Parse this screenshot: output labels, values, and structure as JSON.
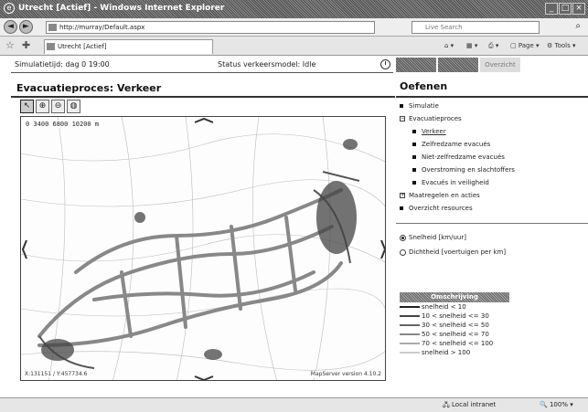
{
  "window": {
    "title": "Utrecht [Actief] - Windows Internet Explorer"
  },
  "addressbar": {
    "url": "http://murray/Default.aspx",
    "search_placeholder": "Live Search"
  },
  "tabs": [
    {
      "label": "Utrecht [Actief]"
    }
  ],
  "toolbar": {
    "page_label": "Page",
    "tools_label": "Tools"
  },
  "app_status": {
    "sim_time": "Simulatietijd: dag 0 19:00",
    "model_status": "Status verkeersmodel: Idle"
  },
  "top_tabs": {
    "active": "",
    "inactive": "Overzicht"
  },
  "left_panel": {
    "title": "Evacuatieproces: Verkeer"
  },
  "map": {
    "scale_text": "0    3400    6800    10200 m",
    "coords": "X:131151 / Y:457734.6",
    "credit": "MapServer version 4.10.2"
  },
  "right_panel": {
    "title": "Oefenen",
    "tree": [
      {
        "label": "Simulatie",
        "level": 0,
        "marker": "bullet"
      },
      {
        "label": "Evacuatieproces",
        "level": 0,
        "marker": "minus"
      },
      {
        "label": "Verkeer",
        "level": 1,
        "marker": "bullet",
        "link": true
      },
      {
        "label": "Zelfredzame evacués",
        "level": 1,
        "marker": "bullet"
      },
      {
        "label": "Niet-zelfredzame evacués",
        "level": 1,
        "marker": "bullet"
      },
      {
        "label": "Overstroming en slachtoffers",
        "level": 1,
        "marker": "bullet"
      },
      {
        "label": "Evacués in veiligheid",
        "level": 1,
        "marker": "bullet"
      },
      {
        "label": "Maatregelen en acties",
        "level": 0,
        "marker": "plus"
      },
      {
        "label": "Overzicht resources",
        "level": 0,
        "marker": "bullet"
      }
    ],
    "options": [
      {
        "label": "Snelheid [km/uur]",
        "selected": true
      },
      {
        "label": "Dichtheid [voertuigen per km]",
        "selected": false
      }
    ],
    "legend": {
      "title": "Omschrijving",
      "items": [
        {
          "label": "snelheid < 10",
          "color": "#222222"
        },
        {
          "label": "10 < snelheid <= 30",
          "color": "#444444"
        },
        {
          "label": "30 < snelheid <= 50",
          "color": "#666666"
        },
        {
          "label": "50 < snelheid <= 70",
          "color": "#888888"
        },
        {
          "label": "70 < snelheid <= 100",
          "color": "#aaaaaa"
        },
        {
          "label": "snelheid > 100",
          "color": "#cccccc"
        }
      ]
    }
  },
  "statusbar": {
    "zone": "Local intranet",
    "zoom": "100%"
  }
}
